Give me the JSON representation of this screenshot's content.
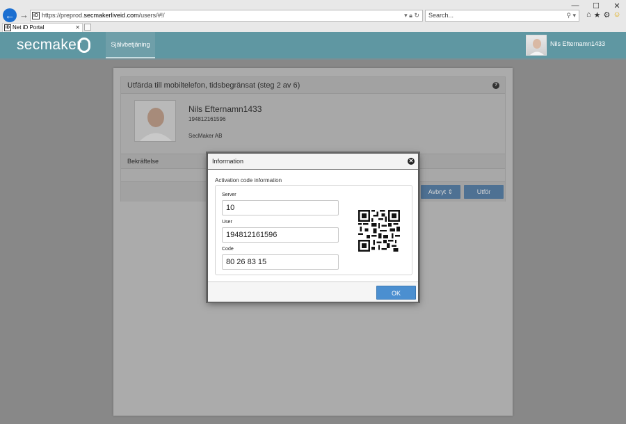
{
  "browser": {
    "url_prefix": "https://",
    "url_sub": "preprod.",
    "url_host": "secmakerliveid.com",
    "url_path": "/users/#!/",
    "search_placeholder": "Search...",
    "tab_title": "Net iD Portal",
    "favicon_text": "iD"
  },
  "header": {
    "logo_text": "secmaker",
    "nav_tab": "Självbetjäning",
    "user_name": "Nils Efternamn1433"
  },
  "card": {
    "title": "Utfärda till mobiltelefon, tidsbegränsat (steg 2 av 6)",
    "user_name": "Nils Efternamn1433",
    "user_id": "194812161596",
    "organization": "SecMaker AB",
    "confirm_label": "Bekräftelse",
    "cancel_label": "Avbryt ⇕",
    "execute_label": "Utför"
  },
  "modal": {
    "title": "Information",
    "section_title": "Activation code information",
    "server_label": "Server",
    "server_value": "10",
    "user_label": "User",
    "user_value": "194812161596",
    "code_label": "Code",
    "code_value": "80 26 83 15",
    "ok_label": "OK"
  },
  "colors": {
    "appbar": "#5f97a2",
    "primary_button": "#4b8fd0",
    "nav_back": "#1c6fd1"
  }
}
